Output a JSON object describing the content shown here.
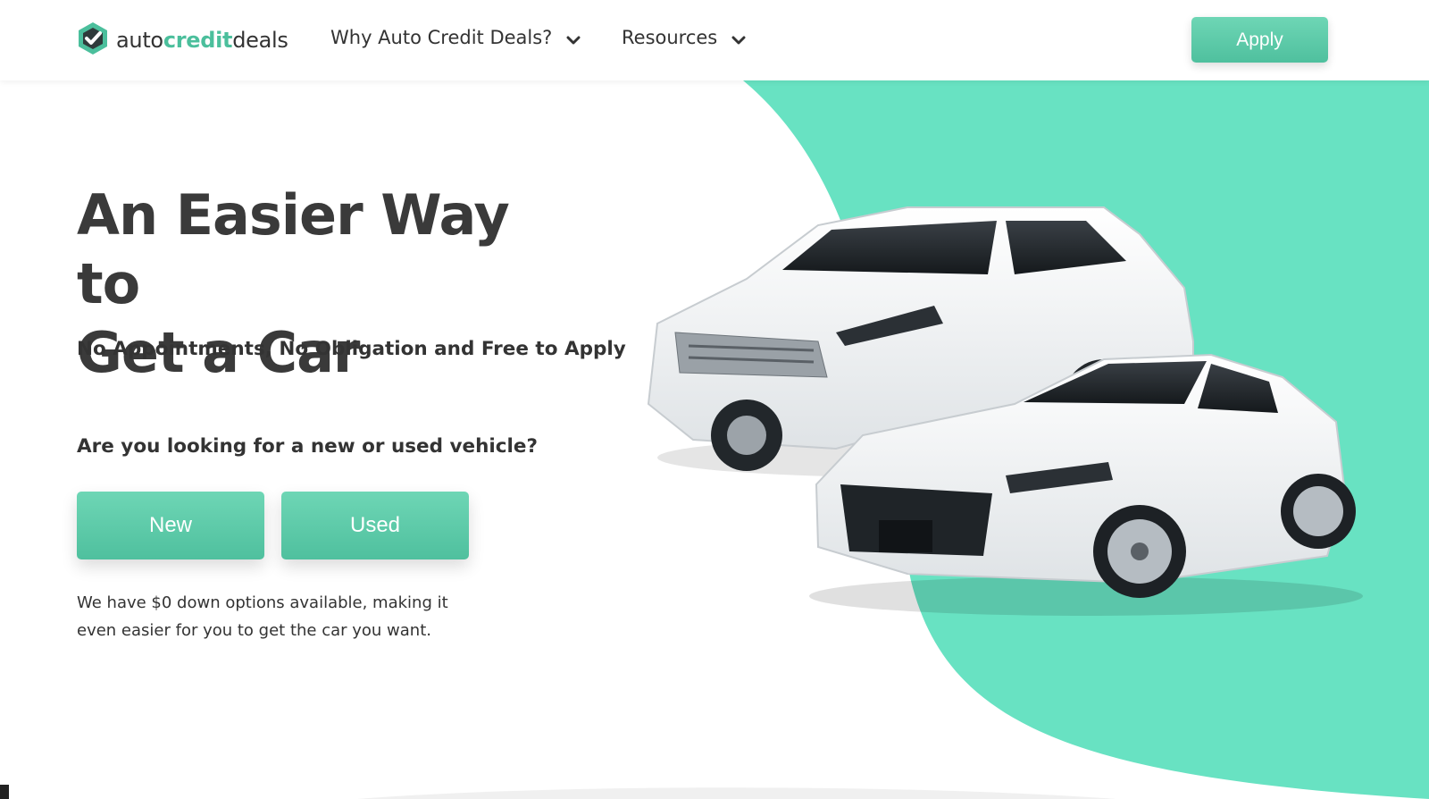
{
  "header": {
    "logo": {
      "text_part1": "auto",
      "text_part2": "credit",
      "text_part3": "deals",
      "icon": "shield-check-icon"
    },
    "nav": [
      {
        "label": "Why Auto Credit Deals?",
        "icon": "chevron-down-icon"
      },
      {
        "label": "Resources",
        "icon": "chevron-down-icon"
      }
    ],
    "apply_label": "Apply"
  },
  "hero": {
    "headline_line1": "An Easier Way to",
    "headline_line2": "Get a Car",
    "subhead": "No Appointments, No Obligation and Free to Apply",
    "question": "Are you looking for a new or used vehicle?",
    "new_label": "New",
    "used_label": "Used",
    "note": "We have $0 down options available, making it even easier for you to get the car you want."
  },
  "colors": {
    "accent": "#4fc09e",
    "accent_light": "#6ed6b5",
    "hero_blob": "#68e2c2",
    "text": "#333333"
  }
}
